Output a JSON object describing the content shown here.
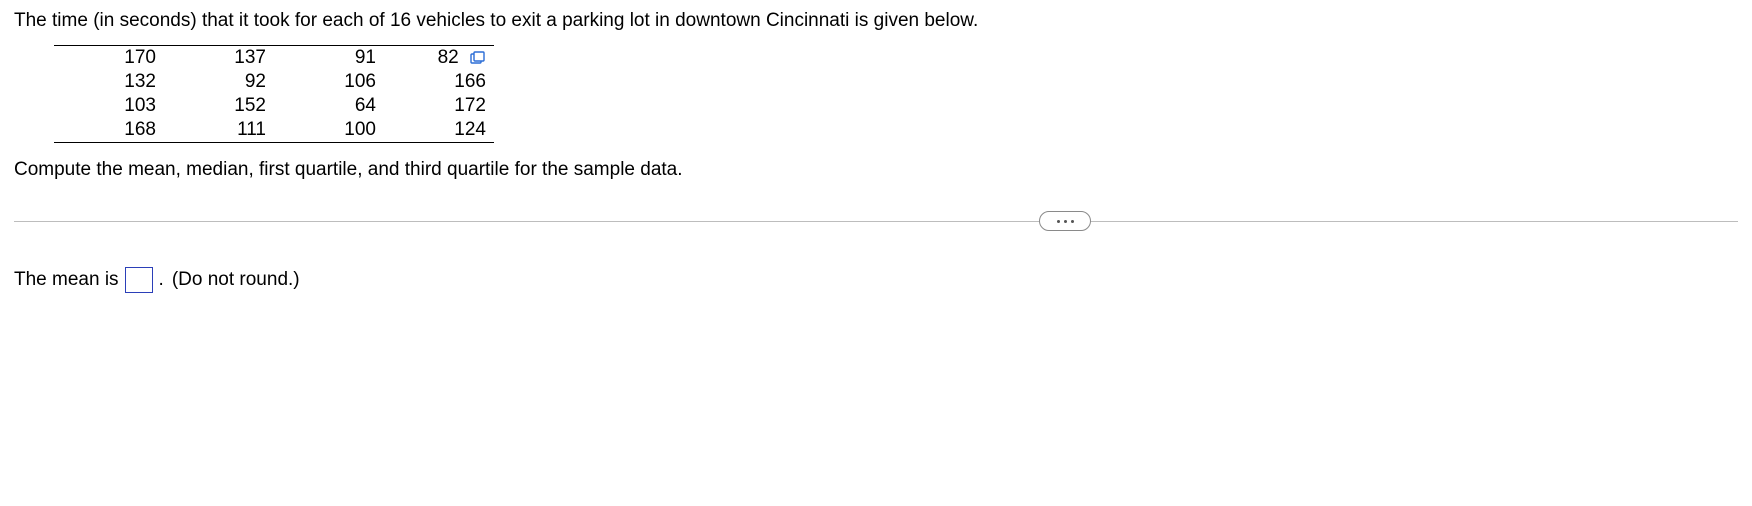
{
  "question": {
    "lead": "The time (in seconds) that it took for each of 16 vehicles to exit a parking lot in downtown Cincinnati is given below.",
    "table": {
      "rows": [
        [
          "170",
          "137",
          "91",
          "82"
        ],
        [
          "132",
          "92",
          "106",
          "166"
        ],
        [
          "103",
          "152",
          "64",
          "172"
        ],
        [
          "168",
          "111",
          "100",
          "124"
        ]
      ]
    },
    "instruction": "Compute the mean, median, first quartile, and third quartile for the sample data."
  },
  "answer": {
    "prefix": "The mean is",
    "value": "",
    "period": ".",
    "hint": "(Do not round.)"
  },
  "icons": {
    "copy": "copy-icon",
    "more": "more-options"
  }
}
